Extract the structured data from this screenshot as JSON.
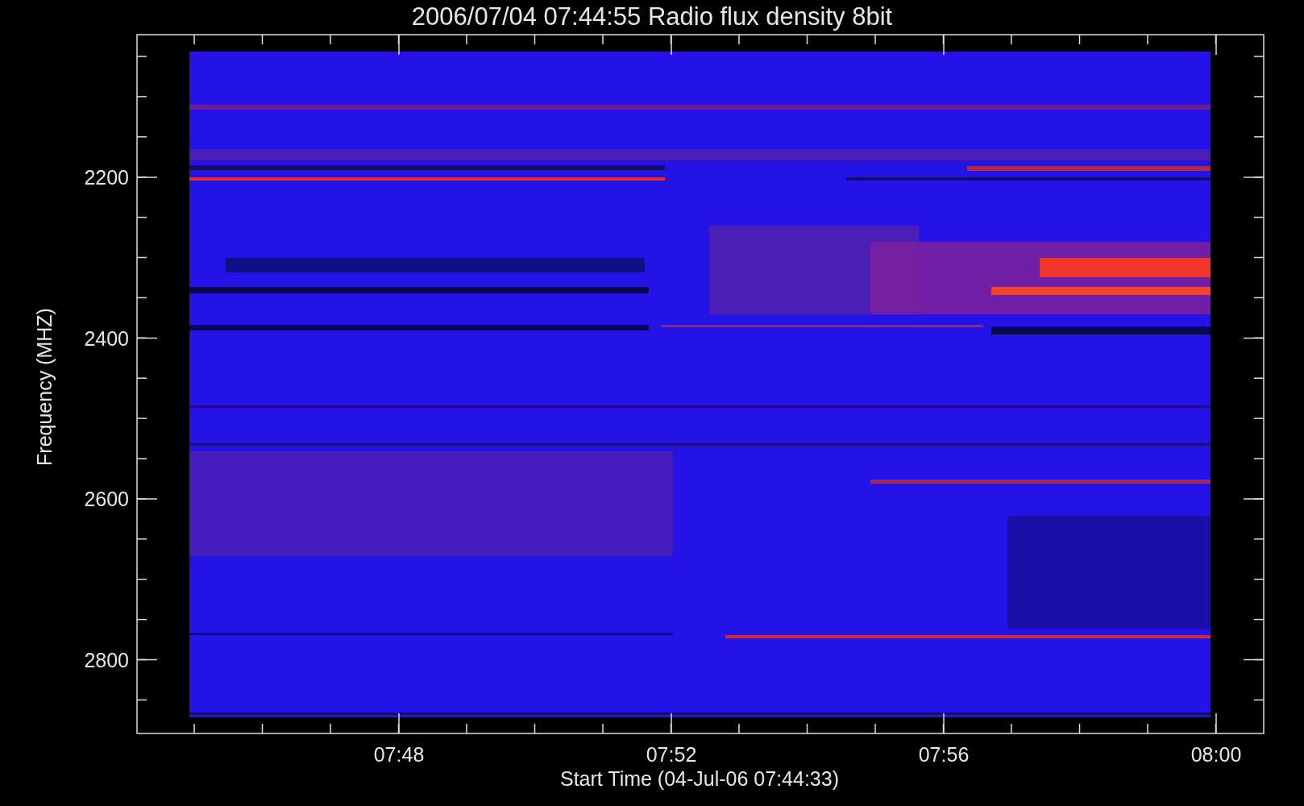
{
  "title": "2006/07/04 07:44:55 Radio flux density 8bit",
  "y_axis": {
    "label": "Frequency (MHZ)",
    "ticks": [
      "2200",
      "2400",
      "2600",
      "2800"
    ]
  },
  "x_axis": {
    "label": "Start Time (04-Jul-06 07:44:33)",
    "ticks": [
      "07:48",
      "07:52",
      "07:56",
      "08:00"
    ]
  }
}
